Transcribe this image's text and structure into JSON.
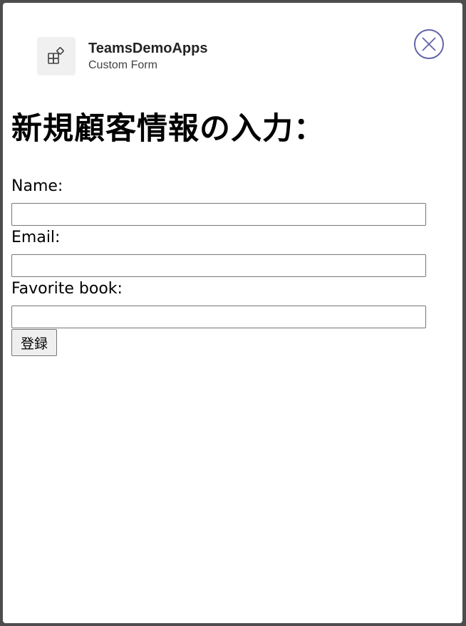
{
  "dialog": {
    "app_name": "TeamsDemoApps",
    "app_subtitle": "Custom Form",
    "close_label": "Close"
  },
  "form": {
    "title": "新規顧客情報の入力：",
    "fields": [
      {
        "label": "Name:",
        "value": ""
      },
      {
        "label": "Email:",
        "value": ""
      },
      {
        "label": "Favorite book:",
        "value": ""
      }
    ],
    "submit_label": "登録"
  },
  "colors": {
    "close_accent": "#6264a7",
    "backdrop": "#4d4d4d"
  }
}
